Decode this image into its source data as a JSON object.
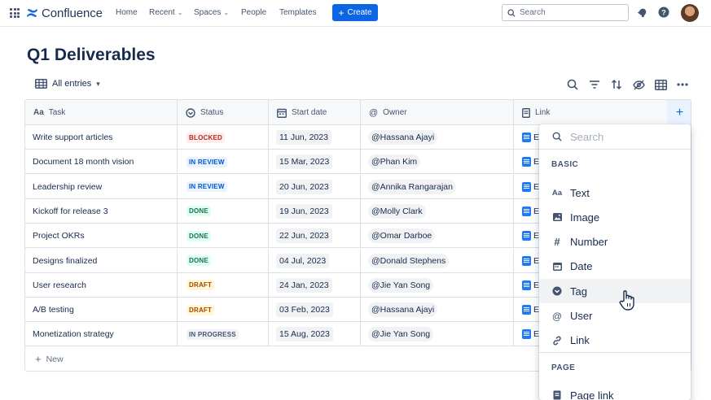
{
  "app": {
    "name": "Confluence"
  },
  "nav": {
    "home": "Home",
    "recent": "Recent",
    "spaces": "Spaces",
    "people": "People",
    "templates": "Templates",
    "create": "Create",
    "search_placeholder": "Search"
  },
  "page": {
    "title": "Q1 Deliverables",
    "view": "All entries",
    "new_row": "New"
  },
  "columns": [
    "Task",
    "Status",
    "Start date",
    "Owner",
    "Link"
  ],
  "rows": [
    {
      "task": "Write support articles",
      "status": "BLOCKED",
      "date": "11 Jun, 2023",
      "owner": "@Hassana Ajayi",
      "link": "E"
    },
    {
      "task": "Document 18 month vision",
      "status": "IN REVIEW",
      "date": "15 Mar, 2023",
      "owner": "@Phan Kim",
      "link": "E"
    },
    {
      "task": "Leadership review",
      "status": "IN REVIEW",
      "date": "20 Jun, 2023",
      "owner": "@Annika Rangarajan",
      "link": "E"
    },
    {
      "task": "Kickoff for release 3",
      "status": "DONE",
      "date": "19 Jun, 2023",
      "owner": "@Molly Clark",
      "link": "E"
    },
    {
      "task": "Project OKRs",
      "status": "DONE",
      "date": "22 Jun, 2023",
      "owner": "@Omar Darboe",
      "link": "E"
    },
    {
      "task": "Designs finalized",
      "status": "DONE",
      "date": "04 Jul, 2023",
      "owner": "@Donald Stephens",
      "link": "E"
    },
    {
      "task": "User research",
      "status": "DRAFT",
      "date": "24 Jan, 2023",
      "owner": "@Jie Yan Song",
      "link": "E"
    },
    {
      "task": "A/B testing",
      "status": "DRAFT",
      "date": "03 Feb, 2023",
      "owner": "@Hassana Ajayi",
      "link": "E"
    },
    {
      "task": "Monetization strategy",
      "status": "IN PROGRESS",
      "date": "15 Aug, 2023",
      "owner": "@Jie Yan Song",
      "link": "E"
    }
  ],
  "status_colors": {
    "BLOCKED": {
      "bg": "#ffeceb",
      "fg": "#ae2e24"
    },
    "IN REVIEW": {
      "bg": "#e9f2ff",
      "fg": "#0055cc"
    },
    "DONE": {
      "bg": "#dcfff1",
      "fg": "#216e4e"
    },
    "DRAFT": {
      "bg": "#fff7d6",
      "fg": "#a54800"
    },
    "IN PROGRESS": {
      "bg": "#f1f2f4",
      "fg": "#44546f"
    }
  },
  "dropdown": {
    "search_placeholder": "Search",
    "section_basic": "BASIC",
    "items": [
      {
        "label": "Text",
        "icon": "text-icon"
      },
      {
        "label": "Image",
        "icon": "image-icon"
      },
      {
        "label": "Number",
        "icon": "number-icon"
      },
      {
        "label": "Date",
        "icon": "calendar-icon"
      },
      {
        "label": "Tag",
        "icon": "tag-icon"
      },
      {
        "label": "User",
        "icon": "at-icon"
      },
      {
        "label": "Link",
        "icon": "link-icon"
      }
    ],
    "section_page": "PAGE",
    "page_items": [
      {
        "label": "Page link",
        "icon": "page-icon"
      }
    ]
  },
  "accent": "#0c66e4"
}
